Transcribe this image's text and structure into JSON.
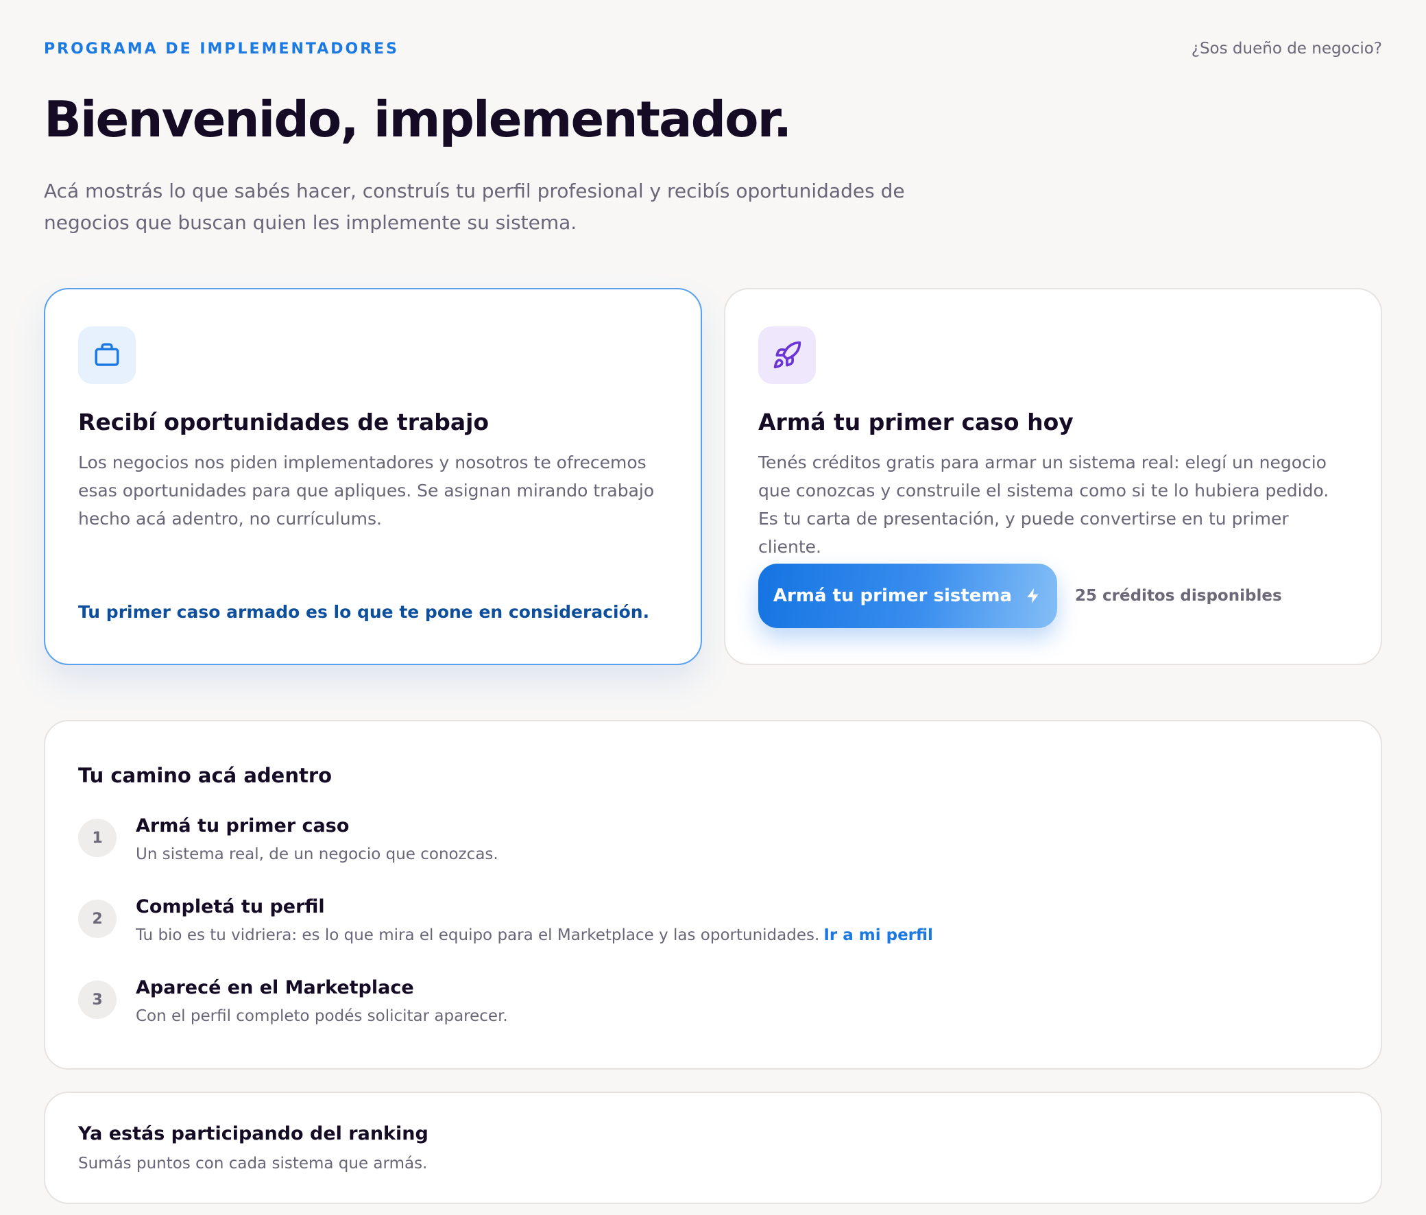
{
  "header": {
    "eyebrow": "PROGRAMA DE IMPLEMENTADORES",
    "owner_link": "¿Sos dueño de negocio?"
  },
  "hero": {
    "title": "Bienvenido, implementador.",
    "subtitle": "Acá mostrás lo que sabés hacer, construís tu perfil profesional y recibís oportunidades de negocios que buscan quien les implemente su sistema."
  },
  "cards": {
    "opportunities": {
      "icon": "briefcase-icon",
      "title": "Recibí oportunidades de trabajo",
      "text": "Los negocios nos piden implementadores y nosotros te ofrecemos esas oportunidades para que apliques. Se asignan mirando trabajo hecho acá adentro, no currículums.",
      "link": "Tu primer caso armado es lo que te pone en consideración."
    },
    "first_case": {
      "icon": "rocket-icon",
      "title": "Armá tu primer caso hoy",
      "text": "Tenés créditos gratis para armar un sistema real: elegí un negocio que conozcas y construile el sistema como si te lo hubiera pedido. Es tu carta de presentación, y puede convertirse en tu primer cliente.",
      "button_label": "Armá tu primer sistema",
      "button_icon": "lightning-icon",
      "credits": "25 créditos disponibles"
    }
  },
  "path": {
    "title": "Tu camino acá adentro",
    "steps": [
      {
        "num": "1",
        "title": "Armá tu primer caso",
        "desc": "Un sistema real, de un negocio que conozcas."
      },
      {
        "num": "2",
        "title": "Completá tu perfil",
        "desc": "Tu bio es tu vidriera: es lo que mira el equipo para el Marketplace y las oportunidades.",
        "link": "Ir a mi perfil"
      },
      {
        "num": "3",
        "title": "Aparecé en el Marketplace",
        "desc": "Con el perfil completo podés solicitar aparecer."
      }
    ]
  },
  "ranking": {
    "title": "Ya estás participando del ranking",
    "desc": "Sumás puntos con cada sistema que armás."
  },
  "colors": {
    "accent": "#1a7ae2",
    "link_dark": "#0d4f9c",
    "icon_purple": "#6b35d6",
    "background": "#f8f7f6"
  }
}
